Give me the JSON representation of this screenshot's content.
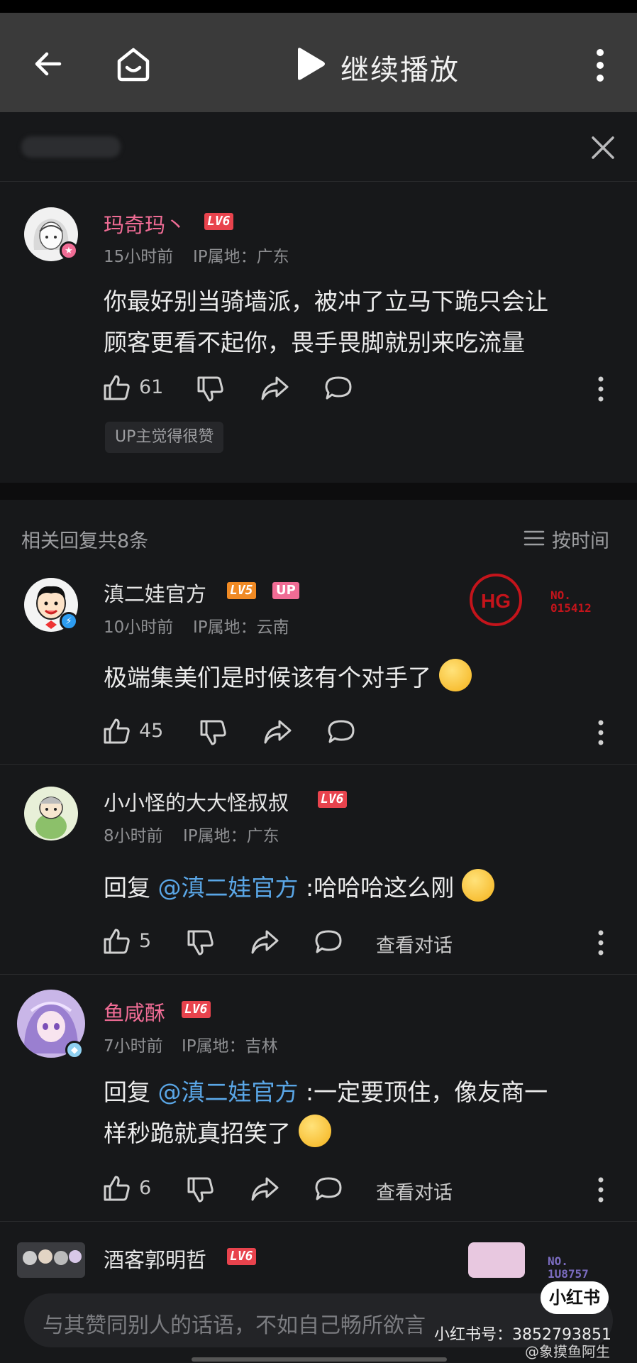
{
  "topbar": {
    "play_label": "继续播放"
  },
  "main_comment": {
    "username": "玛奇玛丶",
    "level": "LV6",
    "time": "15小时前",
    "ip": "IP属地：广东",
    "text_line1": "你最好别当骑墙派，被冲了立马下跪只会让",
    "text_line2": "顾客更看不起你，畏手畏脚就别来吃流量",
    "likes": "61",
    "up_tag": "UP主觉得很赞"
  },
  "replies": {
    "header": "相关回复共8条",
    "sort_label": "按时间",
    "items": [
      {
        "username": "滇二娃官方",
        "level": "LV5",
        "up": "UP",
        "time": "10小时前",
        "ip": "IP属地：云南",
        "text": "极端集美们是时候该有个对手了",
        "likes": "45",
        "stamp_no": "NO.",
        "stamp_num": "015412"
      },
      {
        "username": "小小怪的大大怪叔叔",
        "level": "LV6",
        "time": "8小时前",
        "ip": "IP属地：广东",
        "reply_prefix": "回复",
        "mention": "@滇二娃官方",
        "text": ":哈哈哈这么刚",
        "likes": "5",
        "view_conv": "查看对话"
      },
      {
        "username": "鱼咸酥",
        "level": "LV6",
        "time": "7小时前",
        "ip": "IP属地：吉林",
        "reply_prefix": "回复",
        "mention": "@滇二娃官方",
        "text": ":一定要顶住，像友商一",
        "text_line2": "样秒跪就真招笑了",
        "likes": "6",
        "view_conv": "查看对话"
      },
      {
        "username": "酒客郭明哲",
        "level": "LV6",
        "stamp_no": "NO.",
        "stamp_num": "1U8757"
      }
    ]
  },
  "input": {
    "placeholder": "与其赞同别人的话语，不如自己畅所欲言"
  },
  "watermark": {
    "badge": "小红书",
    "account": "小红书号：3852793851",
    "weibo": "@象摸鱼阿生"
  },
  "colors": {
    "background": "#17181a",
    "topbar": "#3a3a3a",
    "pink_name": "#f06c95",
    "mention": "#5aa6e6",
    "level_red": "#e8434d"
  }
}
